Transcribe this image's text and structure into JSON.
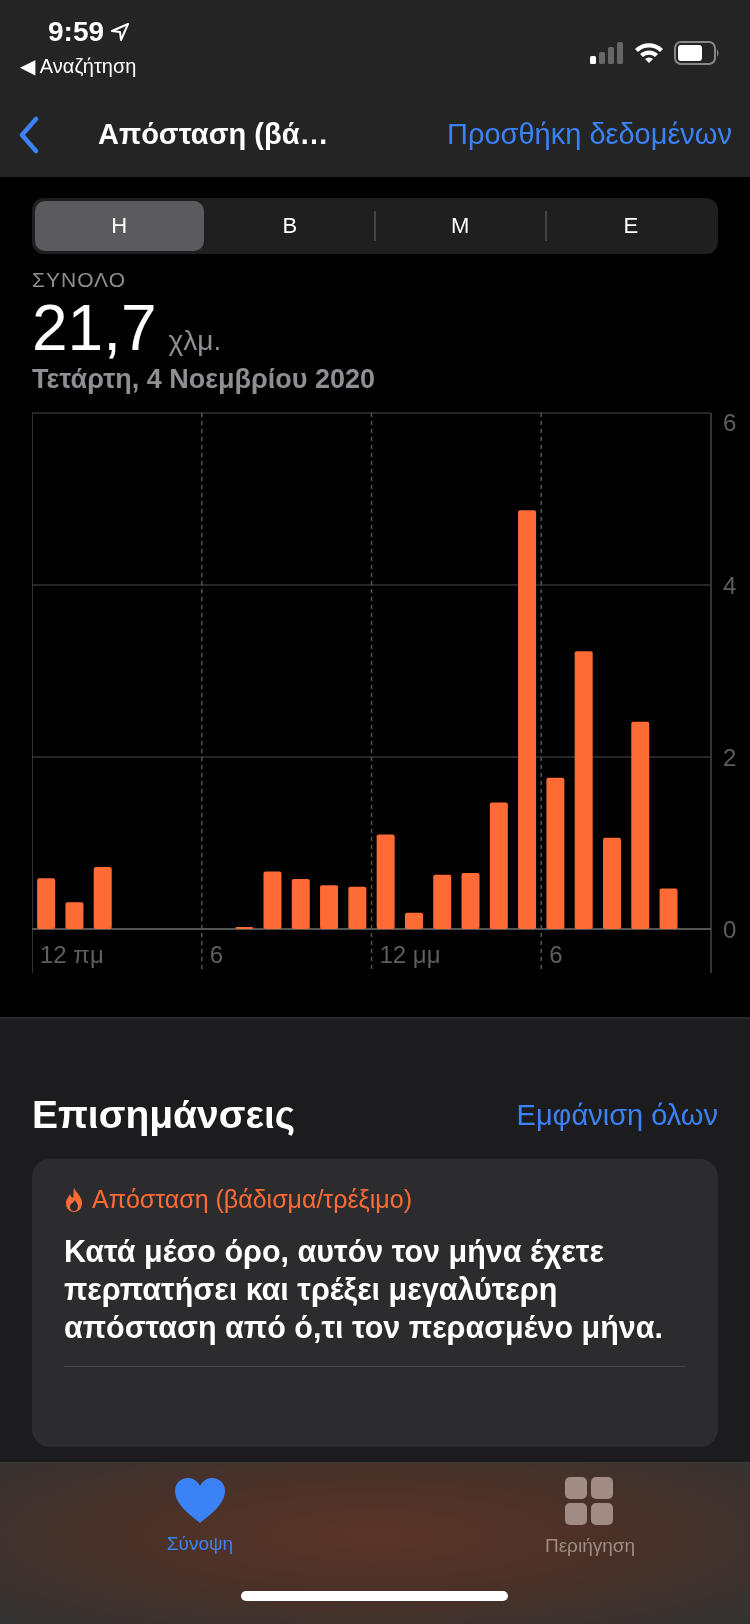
{
  "status_bar": {
    "time": "9:59",
    "back_label": "◀ Αναζήτηση"
  },
  "nav": {
    "title": "Απόσταση (βά…",
    "action": "Προσθήκη δεδομένων"
  },
  "segments": [
    {
      "label": "Η",
      "selected": true
    },
    {
      "label": "Β",
      "selected": false
    },
    {
      "label": "Μ",
      "selected": false
    },
    {
      "label": "Ε",
      "selected": false
    }
  ],
  "summary": {
    "label": "ΣΥΝΟΛΟ",
    "value": "21,7",
    "unit": "χλμ.",
    "date": "Τετάρτη, 4 Νοεμβρίου 2020"
  },
  "chart": {
    "chart_data": {
      "type": "bar",
      "categories": [
        null,
        null,
        null,
        null,
        null,
        null,
        null,
        null,
        null,
        null,
        null,
        null,
        null,
        null,
        null,
        null,
        null,
        null,
        null,
        null,
        null,
        null,
        null,
        null
      ],
      "series": [
        {
          "color": "#ff6b35",
          "values": [
            0.59,
            0.31,
            0.72,
            0,
            0,
            0,
            0,
            0.02,
            0.67,
            0.58,
            0.51,
            0.49,
            1.1,
            0.19,
            0.63,
            0.65,
            1.47,
            4.87,
            1.76,
            3.23,
            1.06,
            2.41,
            0.47,
            0
          ]
        }
      ],
      "ylim": [
        0,
        6
      ],
      "yticks": [
        0,
        2,
        4,
        6
      ]
    },
    "x_axis_labels": [
      "12 πμ",
      "6",
      "12 μμ",
      "6"
    ]
  },
  "highlights": {
    "title": "Επισημάνσεις",
    "action": "Εμφάνιση όλων",
    "cards": [
      {
        "title": "Απόσταση (βάδισμα/τρέξιμο)",
        "text": "Κατά μέσο όρο, αυτόν τον μήνα έχετε περπατήσει και τρέξει μεγαλύτερη απόσταση από ό,τι τον περασμένο μήνα."
      }
    ]
  },
  "tab_bar": [
    {
      "kind": "heart",
      "label": "Σύνοψη",
      "selected": true
    },
    {
      "kind": "grid",
      "label": "Περιήγηση",
      "selected": false
    }
  ]
}
